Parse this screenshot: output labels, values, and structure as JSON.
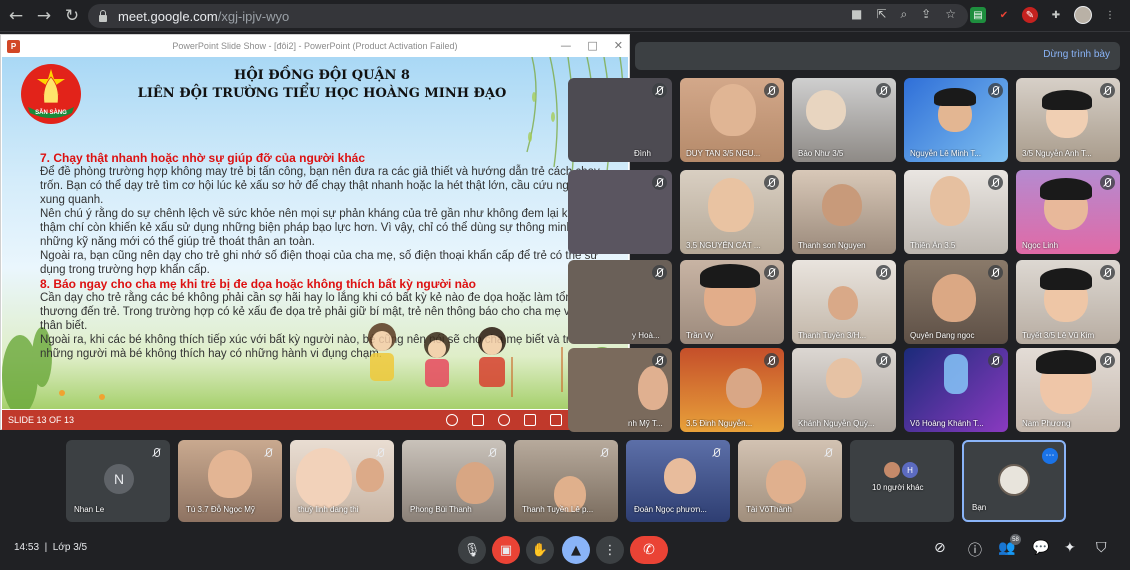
{
  "browser": {
    "url_host": "meet.google.com",
    "url_path": "/xgj-ipjv-wyo"
  },
  "presenting_bar": {
    "stop_label": "Dừng trình bày"
  },
  "powerpoint": {
    "title": "PowerPoint Slide Show - [đôi2] - PowerPoint (Product Activation Failed)",
    "slide_counter": "SLIDE 13 OF 13",
    "header_line1": "HỘI ĐỒNG ĐỘI QUẬN 8",
    "header_line2": "LIÊN ĐỘI TRƯỜNG TIỂU HỌC HOÀNG MINH ĐẠO",
    "emblem_text": "SẴN SÀNG",
    "heading7": "7. Chạy thật nhanh hoặc nhờ sự giúp đỡ của người khác",
    "para7a": "Để đề phòng trường hợp không may trẻ bị tấn công, bạn nên đưa ra các giả thiết và hướng dẫn trẻ cách chạy trốn. Bạn có thể dạy trẻ tìm cơ hội lúc kẻ xấu sơ hở để chạy thật nhanh hoặc la hét thật lớn, cầu cứu người xung quanh.",
    "para7b": "Nên chú ý rằng do sự chênh lệch về sức khỏe nên mọi sự phản kháng của trẻ gần như không đem lại kết quả, thậm chí còn khiến kẻ xấu sử dụng những biện pháp bạo lực hơn. Vì vậy, chỉ có thể dùng sự thông minh và những kỹ năng mới có thể giúp trẻ thoát thân an toàn.",
    "para7c": "Ngoài ra, bạn cũng nên dạy cho trẻ ghi nhớ số điện thoại của cha mẹ, số điện thoại khẩn cấp để trẻ có thể sử dụng trong trường hợp khẩn cấp.",
    "heading8": "8. Báo ngay cho cha mẹ khi trẻ bị đe dọa hoặc không thích bất kỳ người nào",
    "para8a": "Cần dạy cho trẻ rằng các bé không phải cần sợ hãi hay lo lắng khi có bất kỳ kẻ nào đe dọa hoặc làm tổn thương đến trẻ. Trong trường hợp có kẻ xấu đe dọa trẻ phải giữ bí mật, trẻ nên thông báo cho cha mẹ và người thân biết.",
    "para8b": "Ngoài ra, khi các bé không thích tiếp xúc với bất kỳ người nào, bé cũng nên nói sẽ cho cha mẹ biết và tránh xa những người mà bé không thích hay có những hành vi đụng chạm."
  },
  "tiles": [
    {
      "name": "Đình"
    },
    {
      "name": "DUY TAN 3/5 NGU..."
    },
    {
      "name": "Bảo Như 3/5"
    },
    {
      "name": "Nguyễn Lê Minh T..."
    },
    {
      "name": "3/5 Nguyễn Anh T..."
    },
    {
      "name": ""
    },
    {
      "name": "3.5 NGUYỄN CÁT ..."
    },
    {
      "name": "Thanh son Nguyen"
    },
    {
      "name": "Thiên Ân 3.5"
    },
    {
      "name": "Ngọc Linh"
    },
    {
      "name": "y Hoà..."
    },
    {
      "name": "Trần Vy"
    },
    {
      "name": "Thanh Tuyền 3/H..."
    },
    {
      "name": "Quyên Dang ngoc"
    },
    {
      "name": "Tuyết 3/5 Lê Vũ Kim"
    },
    {
      "name": "nh Mỹ T..."
    },
    {
      "name": "3.5 Đinh Nguyễn..."
    },
    {
      "name": "Khánh Nguyễn Quỳ..."
    },
    {
      "name": "Võ Hoàng Khánh T..."
    },
    {
      "name": "Nam Phương"
    }
  ],
  "bottom_tiles": [
    {
      "name": "Nhan Le",
      "initial": "N"
    },
    {
      "name": "Tú 3.7 Đỗ Ngọc Mỹ"
    },
    {
      "name": "thuỳ linh dang thi"
    },
    {
      "name": "Phong Bùi Thanh"
    },
    {
      "name": "Thanh Tuyền Lê p..."
    },
    {
      "name": "Đoàn Ngọc phươn..."
    },
    {
      "name": "Tài VõThành"
    },
    {
      "name": "10 người khác",
      "initial": "H"
    },
    {
      "name": "Bạn"
    }
  ],
  "footer": {
    "time": "14:53",
    "class": "Lớp 3/5",
    "participants_count": "58"
  }
}
